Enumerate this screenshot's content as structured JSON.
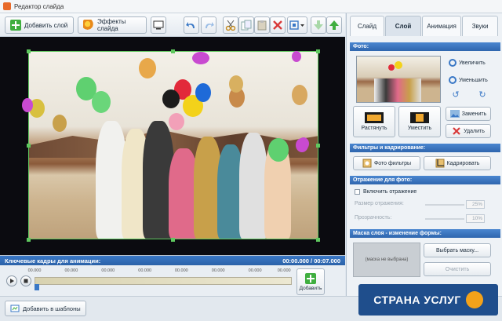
{
  "window": {
    "title": "Редактор слайда"
  },
  "toolbar": {
    "add_layer_label": "Добавить слой",
    "slide_effects_label": "Эффекты слайда"
  },
  "panel": {
    "tabs": [
      {
        "label": "Слайд"
      },
      {
        "label": "Слой"
      },
      {
        "label": "Анимация"
      },
      {
        "label": "Звуки"
      }
    ],
    "photo_section": {
      "title": "Фото:",
      "zoom_in": "Увеличить",
      "zoom_out": "Уменьшить",
      "stretch": "Растянуть",
      "fit": "Уместить",
      "replace": "Заменить",
      "delete": "Удалить"
    },
    "filters_section": {
      "title": "Фильтры и кадрирование:",
      "photo_filters": "Фото фильтры",
      "crop": "Кадрировать"
    },
    "reflection_section": {
      "title": "Отражение для фото:",
      "enable_reflection": "Включить отражение",
      "reflection_size_label": "Размер отражения:",
      "reflection_size_value": "25%",
      "transparency_label": "Прозрачность:",
      "transparency_value": "10%"
    },
    "mask_section": {
      "title": "Маска слоя - изменение формы:",
      "mask_placeholder": "(маска не выбрана)",
      "choose_mask": "Выбрать маску...",
      "clear": "Очистить"
    }
  },
  "timeline": {
    "title": "Ключевые кадры для анимации:",
    "time_display": "00:00.000 / 00:07.000",
    "ruler_labels": [
      "00.000",
      "00.000",
      "00.000",
      "00.000",
      "00.000",
      "00.000",
      "00.000",
      "00.000"
    ],
    "add_label": "Добавить"
  },
  "bottom": {
    "add_to_templates": "Добавить в шаблоны"
  },
  "watermark": {
    "text": "СТРАНА УСЛУГ"
  }
}
